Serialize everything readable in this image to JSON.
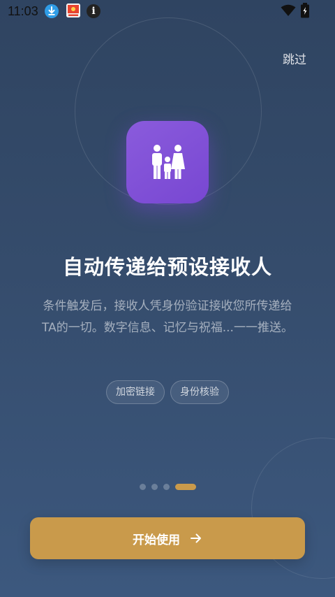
{
  "status_bar": {
    "time": "11:03",
    "icons": [
      "download-icon",
      "app-notification-icon",
      "info-icon",
      "wifi-icon",
      "battery-icon"
    ]
  },
  "onboarding": {
    "skip_label": "跳过",
    "feature_icon": "family-icon",
    "title": "自动传递给预设接收人",
    "description": "条件触发后，接收人凭身份验证接收您所传递给TA的一切。数字信息、记忆与祝福...一一推送。",
    "tags": [
      "加密链接",
      "身份核验"
    ],
    "pager": {
      "total": 4,
      "active_index": 3
    },
    "start_button_label": "开始使用",
    "start_button_icon": "arrow-right-icon"
  },
  "colors": {
    "background_top": "#2f4461",
    "background_bottom": "#3c587e",
    "icon_purple": "#7f50d6",
    "accent_gold": "#c99a4b"
  }
}
